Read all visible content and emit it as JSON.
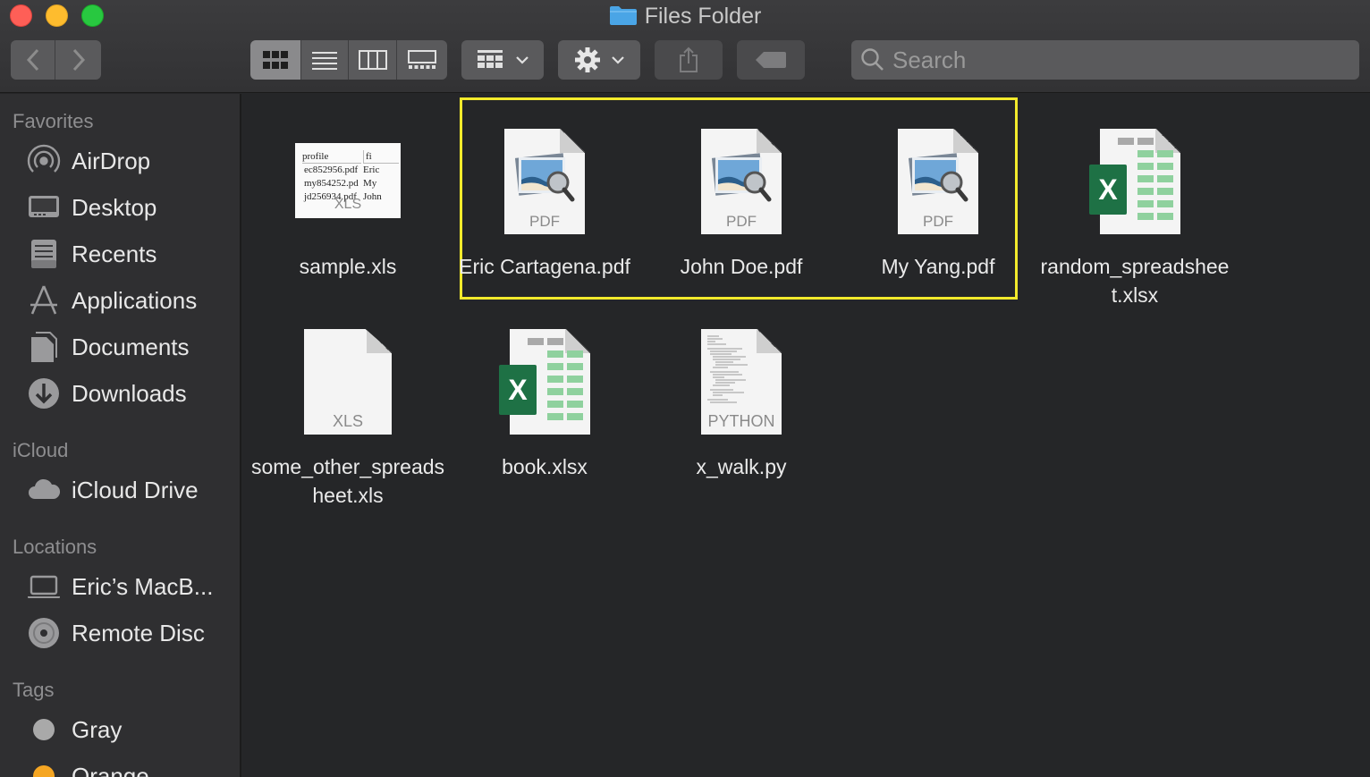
{
  "window": {
    "title": "Files Folder"
  },
  "toolbar": {
    "search_placeholder": "Search",
    "view_modes": [
      "icon-view",
      "list-view",
      "column-view",
      "gallery-view"
    ],
    "active_view": "icon-view"
  },
  "sidebar": {
    "sections": [
      {
        "header": "Favorites",
        "items": [
          {
            "label": "AirDrop",
            "icon": "airdrop-icon"
          },
          {
            "label": "Desktop",
            "icon": "desktop-icon"
          },
          {
            "label": "Recents",
            "icon": "recents-icon"
          },
          {
            "label": "Applications",
            "icon": "applications-icon"
          },
          {
            "label": "Documents",
            "icon": "documents-icon"
          },
          {
            "label": "Downloads",
            "icon": "downloads-icon"
          }
        ]
      },
      {
        "header": "iCloud",
        "items": [
          {
            "label": "iCloud Drive",
            "icon": "cloud-icon"
          }
        ]
      },
      {
        "header": "Locations",
        "items": [
          {
            "label": "Eric’s MacB...",
            "icon": "laptop-icon"
          },
          {
            "label": "Remote Disc",
            "icon": "disc-icon"
          }
        ]
      },
      {
        "header": "Tags",
        "items": [
          {
            "label": "Gray",
            "icon": "gray-tag-icon",
            "color": "#a9a9a9"
          },
          {
            "label": "Orange",
            "icon": "orange-tag-icon",
            "color": "#f5a623"
          }
        ]
      }
    ]
  },
  "files": [
    {
      "name": "sample.xls",
      "kind": "xls-preview",
      "badge": "XLS",
      "preview_rows": [
        [
          "profile",
          "fi"
        ],
        [
          "ec852956.pdf",
          "Eric"
        ],
        [
          "my854252.pd",
          "My"
        ],
        [
          "jd256934.pdf",
          "John"
        ]
      ]
    },
    {
      "name": "Eric Cartagena.pdf",
      "kind": "pdf",
      "badge": "PDF",
      "selected": true
    },
    {
      "name": "John Doe.pdf",
      "kind": "pdf",
      "badge": "PDF",
      "selected": true
    },
    {
      "name": "My Yang.pdf",
      "kind": "pdf",
      "badge": "PDF",
      "selected": true
    },
    {
      "name": "random_spreadsheet.xlsx",
      "kind": "xlsx",
      "badge": "X"
    },
    {
      "name": "some_other_spreadsheet.xls",
      "kind": "xls",
      "badge": "XLS"
    },
    {
      "name": "book.xlsx",
      "kind": "xlsx",
      "badge": "X"
    },
    {
      "name": "x_walk.py",
      "kind": "python",
      "badge": "PYTHON"
    }
  ],
  "colors": {
    "selection_outline": "#f2ea2c",
    "excel_green": "#1e7145",
    "folder_blue": "#4aa5e6"
  }
}
